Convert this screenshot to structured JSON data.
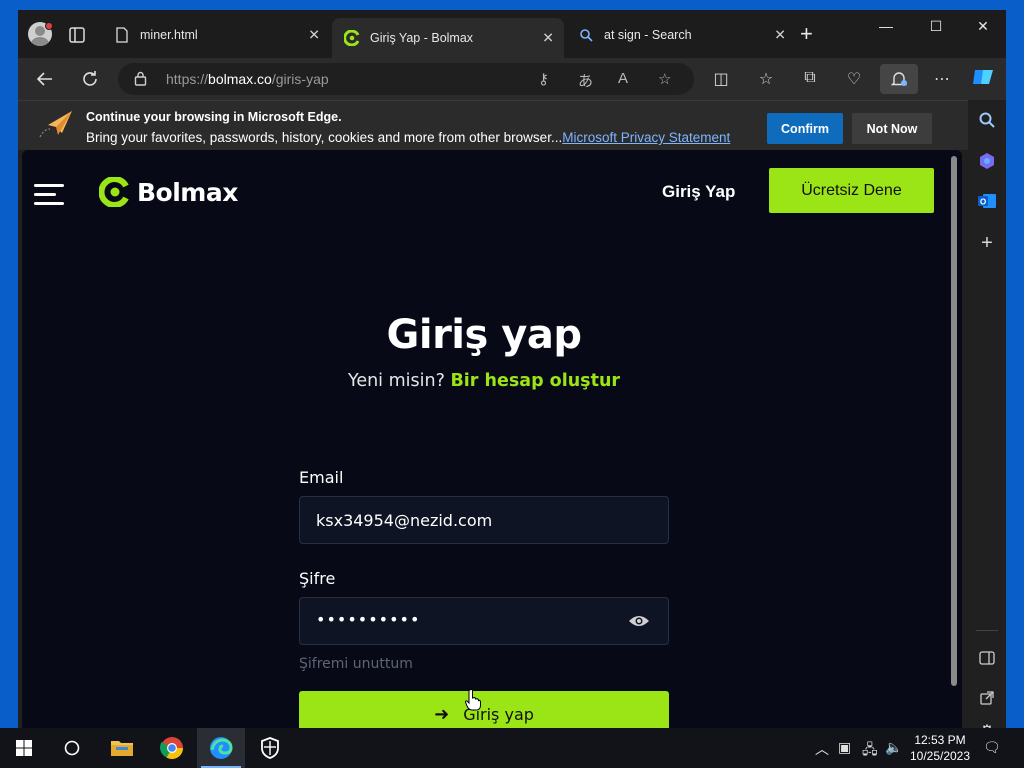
{
  "browser": {
    "tabs": [
      {
        "title": "miner.html",
        "icon": "file-icon"
      },
      {
        "title": "Giriş Yap - Bolmax",
        "icon": "bolmax-icon"
      },
      {
        "title": "at sign - Search",
        "icon": "search-icon"
      }
    ],
    "close_glyph": "✕",
    "new_tab_glyph": "+",
    "url_scheme": "https://",
    "url_host": "bolmax.co",
    "url_path": "/giris-yap"
  },
  "infobar": {
    "title": "Continue your browsing in Microsoft Edge.",
    "message": "Bring your favorites, passwords, history, cookies and more from other browser...",
    "link": "Microsoft Privacy Statement",
    "confirm_label": "Confirm",
    "not_now_label": "Not Now"
  },
  "site": {
    "brand": "Bolmax",
    "nav_login": "Giriş Yap",
    "nav_trial": "Ücretsiz Dene",
    "heading": "Giriş yap",
    "sub_prefix": "Yeni misin?",
    "sub_link": "Bir hesap oluştur",
    "email_label": "Email",
    "email_value": "ksx34954@nezid.com",
    "password_label": "Şifre",
    "password_mask": "••••••••••",
    "forgot_label": "Şifremi unuttum",
    "submit_label": "Giriş yap",
    "accent_color": "#9be416"
  },
  "taskbar": {
    "time": "12:53 PM",
    "date": "10/25/2023"
  }
}
